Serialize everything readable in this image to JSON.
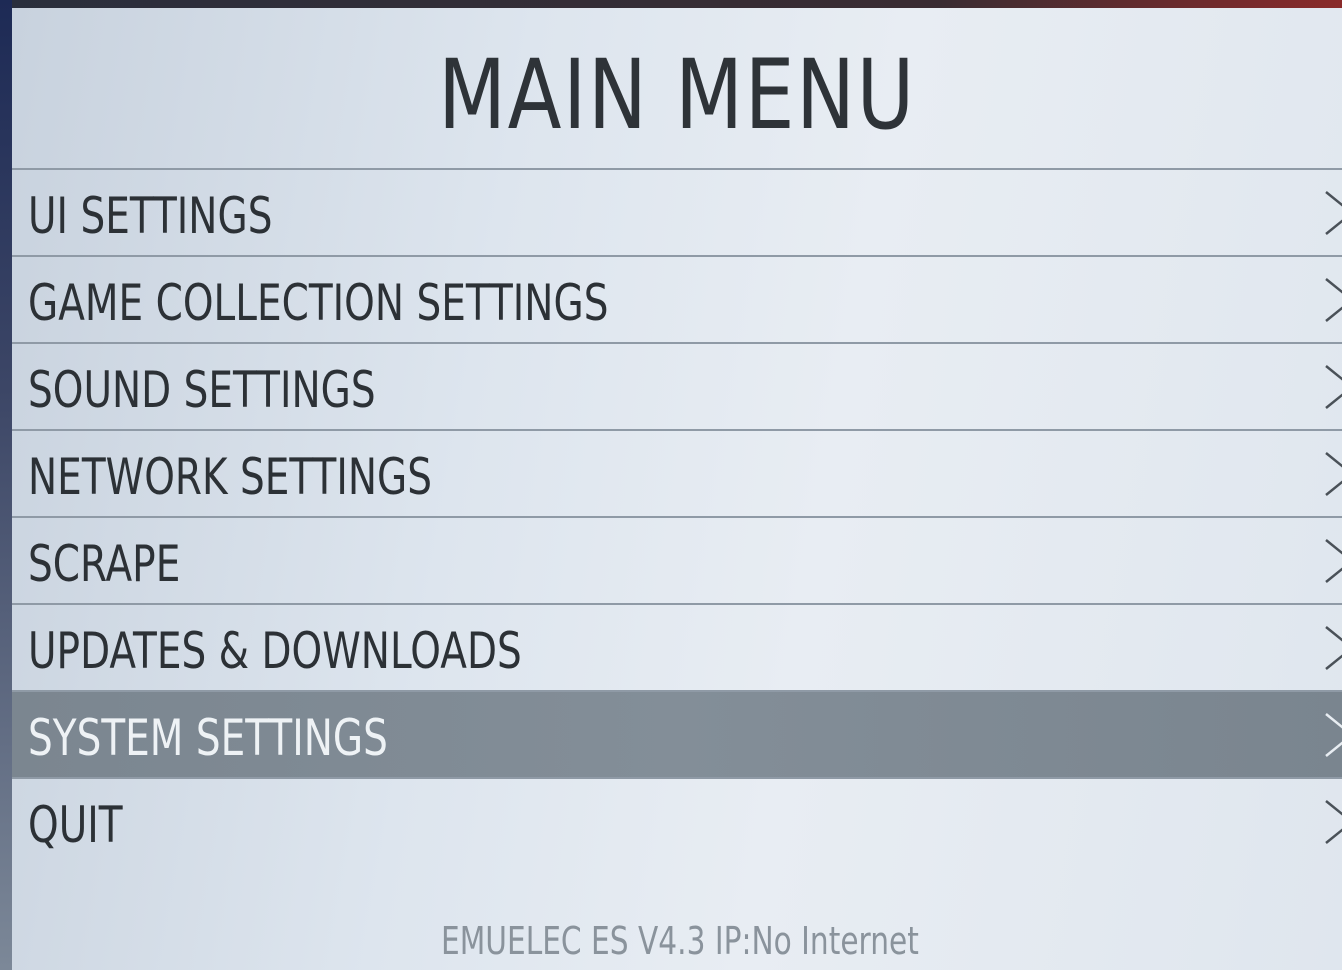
{
  "menu": {
    "title": "MAIN MENU",
    "items": [
      {
        "label": "UI SETTINGS",
        "icon": "chevron-right-icon",
        "selected": false
      },
      {
        "label": "GAME COLLECTION SETTINGS",
        "icon": "chevron-right-icon",
        "selected": false
      },
      {
        "label": "SOUND SETTINGS",
        "icon": "chevron-right-icon",
        "selected": false
      },
      {
        "label": "NETWORK SETTINGS",
        "icon": "chevron-right-icon",
        "selected": false
      },
      {
        "label": "SCRAPE",
        "icon": "chevron-right-icon",
        "selected": false
      },
      {
        "label": "UPDATES & DOWNLOADS",
        "icon": "chevron-right-icon",
        "selected": false
      },
      {
        "label": "SYSTEM SETTINGS",
        "icon": "chevron-right-icon",
        "selected": true
      },
      {
        "label": "QUIT",
        "icon": "chevron-right-icon",
        "selected": false
      }
    ],
    "footer": "EMUELEC ES V4.3 IP:No Internet"
  },
  "colors": {
    "menu_background": "#dde5ee",
    "selected_row": "#808b95",
    "text": "#2c3136",
    "selected_text": "#eef2f5",
    "divider": "#8f9aa6",
    "footer_text": "#8a939c"
  }
}
